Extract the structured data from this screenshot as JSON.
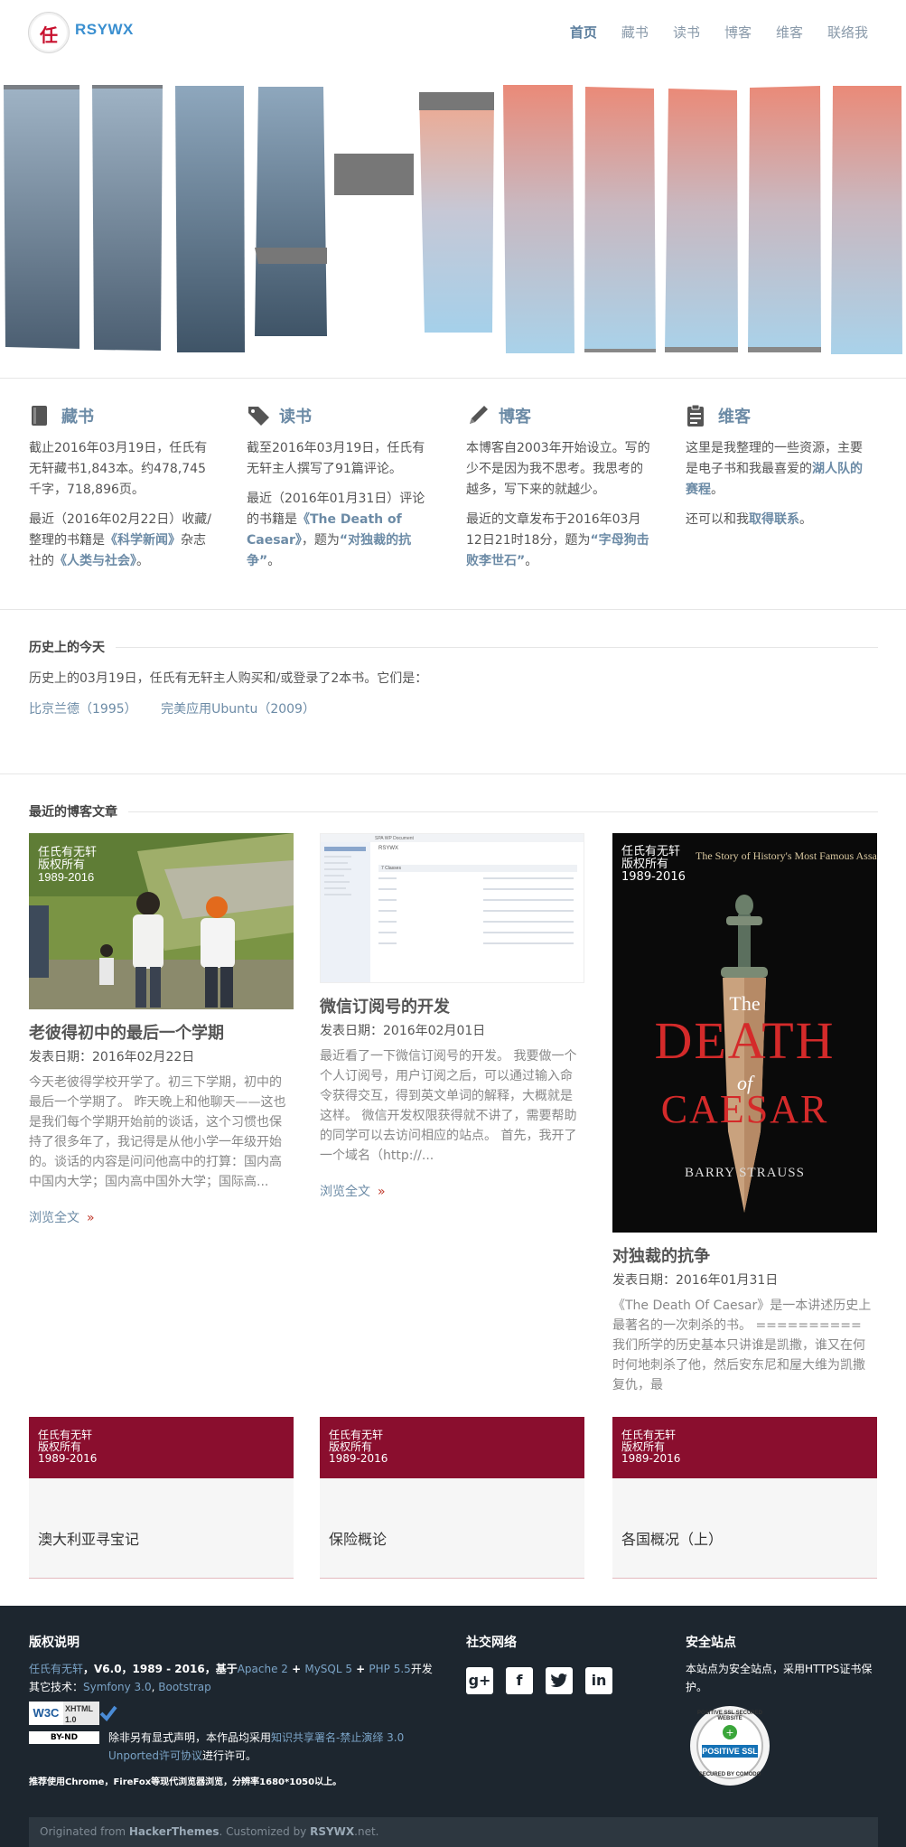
{
  "site": {
    "logo_char": "任",
    "name": "RSYWX"
  },
  "nav": [
    {
      "label": "首页",
      "active": true
    },
    {
      "label": "藏书",
      "active": false
    },
    {
      "label": "读书",
      "active": false
    },
    {
      "label": "博客",
      "active": false
    },
    {
      "label": "维客",
      "active": false
    },
    {
      "label": "联络我",
      "active": false
    }
  ],
  "features": {
    "collection": {
      "title": "藏书",
      "p1": "截止2016年03月19日，任氏有无轩藏书1,843本。约478,745千字，718,896页。",
      "p2_pre": "最近（2016年02月22日）收藏/整理的书籍是",
      "p2_link1": "《科学新闻》",
      "p2_mid": "杂志社的",
      "p2_link2": "《人类与社会》",
      "p2_post": "。"
    },
    "reading": {
      "title": "读书",
      "p1": "截至2016年03月19日，任氏有无轩主人撰写了91篇评论。",
      "p2_pre": "最近（2016年01月31日）评论的书籍是",
      "p2_link1": "《The Death of Caesar》",
      "p2_mid": "，题为",
      "p2_link2": "“对独裁的抗争”",
      "p2_post": "。"
    },
    "blog": {
      "title": "博客",
      "p1": "本博客自2003年开始设立。写的少不是因为我不思考。我思考的越多，写下来的就越少。",
      "p2_pre": "最近的文章发布于2016年03月12日21时18分，题为",
      "p2_link1": "“字母狗击败李世石”",
      "p2_post": "。"
    },
    "wiki": {
      "title": "维客",
      "p1_pre": "这里是我整理的一些资源，主要是电子书和我最喜爱的",
      "p1_link": "湖人队的赛程",
      "p1_post": "。",
      "p2_pre": "还可以和我",
      "p2_link": "取得联系",
      "p2_post": "。"
    }
  },
  "today": {
    "heading": "历史上的今天",
    "text": "历史上的03月19日，任氏有无轩主人购买和/或登录了2本书。它们是：",
    "books": [
      "比京兰德（1995）",
      "完美应用Ubuntu（2009）"
    ]
  },
  "recent": {
    "heading": "最近的博客文章",
    "posts": [
      {
        "title": "老彼得初中的最后一个学期",
        "date": "发表日期：2016年02月22日",
        "excerpt": "今天老彼得学校开学了。初三下学期，初中的最后一个学期了。 昨天晚上和他聊天——这也是我们每个学期开始前的谈话，这个习惯也保持了很多年了，我记得是从他小学一年级开始的。谈话的内容是问问他高中的打算：国内高中国内大学；国内高中国外大学；国际高...",
        "more": "浏览全文",
        "more_arrow": "»"
      },
      {
        "title": "微信订阅号的开发",
        "date": "发表日期：2016年02月01日",
        "excerpt": "最近看了一下微信订阅号的开发。 我要做一个个人订阅号，用户订阅之后，可以通过输入命令获得交互，得到英文单词的解释，大概就是这样。 微信开发权限获得就不讲了，需要帮助的同学可以去访问相应的站点。 首先，我开了一个域名（http://...",
        "more": "浏览全文",
        "more_arrow": "»",
        "screenshot_title": "RSYWX",
        "screenshot_sub": "SPA WP Document",
        "screenshot_tab": "7 Classes"
      },
      {
        "title": "对独裁的抗争",
        "date": "发表日期：2016年01月31日",
        "excerpt": "《The Death Of Caesar》是一本讲述历史上最著名的一次刺杀的书。 ========== 我们所学的历史基本只讲谁是凯撒，谁又在何时何地刺杀了他，然后安东尼和屋大维为凯撒复仇，最",
        "cover": {
          "watermark_line1": "任氏有无轩",
          "watermark_line2": "版权所有",
          "watermark_line3": "1989-2016",
          "tagline": "The Story of History's Most Famous Assassination",
          "the": "The",
          "death": "DEATH",
          "of": "of",
          "caesar": "CAESAR",
          "author": "BARRY STRAUSS"
        }
      }
    ],
    "photo_watermark": {
      "line1": "任氏有无轩",
      "line2": "版权所有",
      "line3": "1989-2016"
    }
  },
  "cards": [
    {
      "w1": "任氏有无轩",
      "w2": "版权所有",
      "w3": "1989-2016",
      "title": "澳大利亚寻宝记"
    },
    {
      "w1": "任氏有无轩",
      "w2": "版权所有",
      "w3": "1989-2016",
      "title": "保险概论"
    },
    {
      "w1": "任氏有无轩",
      "w2": "版权所有",
      "w3": "1989-2016",
      "title": "各国概况（上）"
    }
  ],
  "footer": {
    "copyright_heading": "版权说明",
    "cr_site": "任氏有无轩",
    "cr_version": "，V6.0，1989 - 2016，基于",
    "cr_apache": "Apache 2",
    "cr_plus1": " + ",
    "cr_mysql": "MySQL 5",
    "cr_plus2": " + ",
    "cr_php": "PHP 5.5",
    "cr_dev": "开发",
    "cr_other": "其它技术：",
    "cr_symfony": "Symfony 3.0",
    "cr_comma": ", ",
    "cr_bootstrap": "Bootstrap",
    "w3c": "W3C",
    "xhtml": "XHTML 1.0",
    "cc_badge": "BY-ND",
    "license_pre": "除非另有显式声明，本作品均采用",
    "license_link": "知识共享署名-禁止演绎 3.0 Unported许可协议",
    "license_post": "进行许可。",
    "browser_note": "推荐使用Chrome，FireFox等现代浏览器浏览，分辨率1680*1050以上。",
    "social_heading": "社交网络",
    "social_icons": [
      "g+",
      "f",
      "twitter",
      "in"
    ],
    "secure_heading": "安全站点",
    "secure_text": "本站点为安全站点，采用HTTPS证书保护。",
    "ssl_top": "POSITIVE SSL SECURED WEBSITE",
    "ssl_mid": "POSITIVE SSL",
    "ssl_bottom": "SECURED BY COMODO",
    "bottom_pre": "Originated from ",
    "bottom_ht": "HackerThemes",
    "bottom_mid": ". Customized by ",
    "bottom_rsywx": "RSYWX",
    "bottom_post": ".net."
  },
  "colors": {
    "accent": "#6c8ba6",
    "brand_red": "#8a0e2e",
    "footer_bg": "#1d262f"
  }
}
